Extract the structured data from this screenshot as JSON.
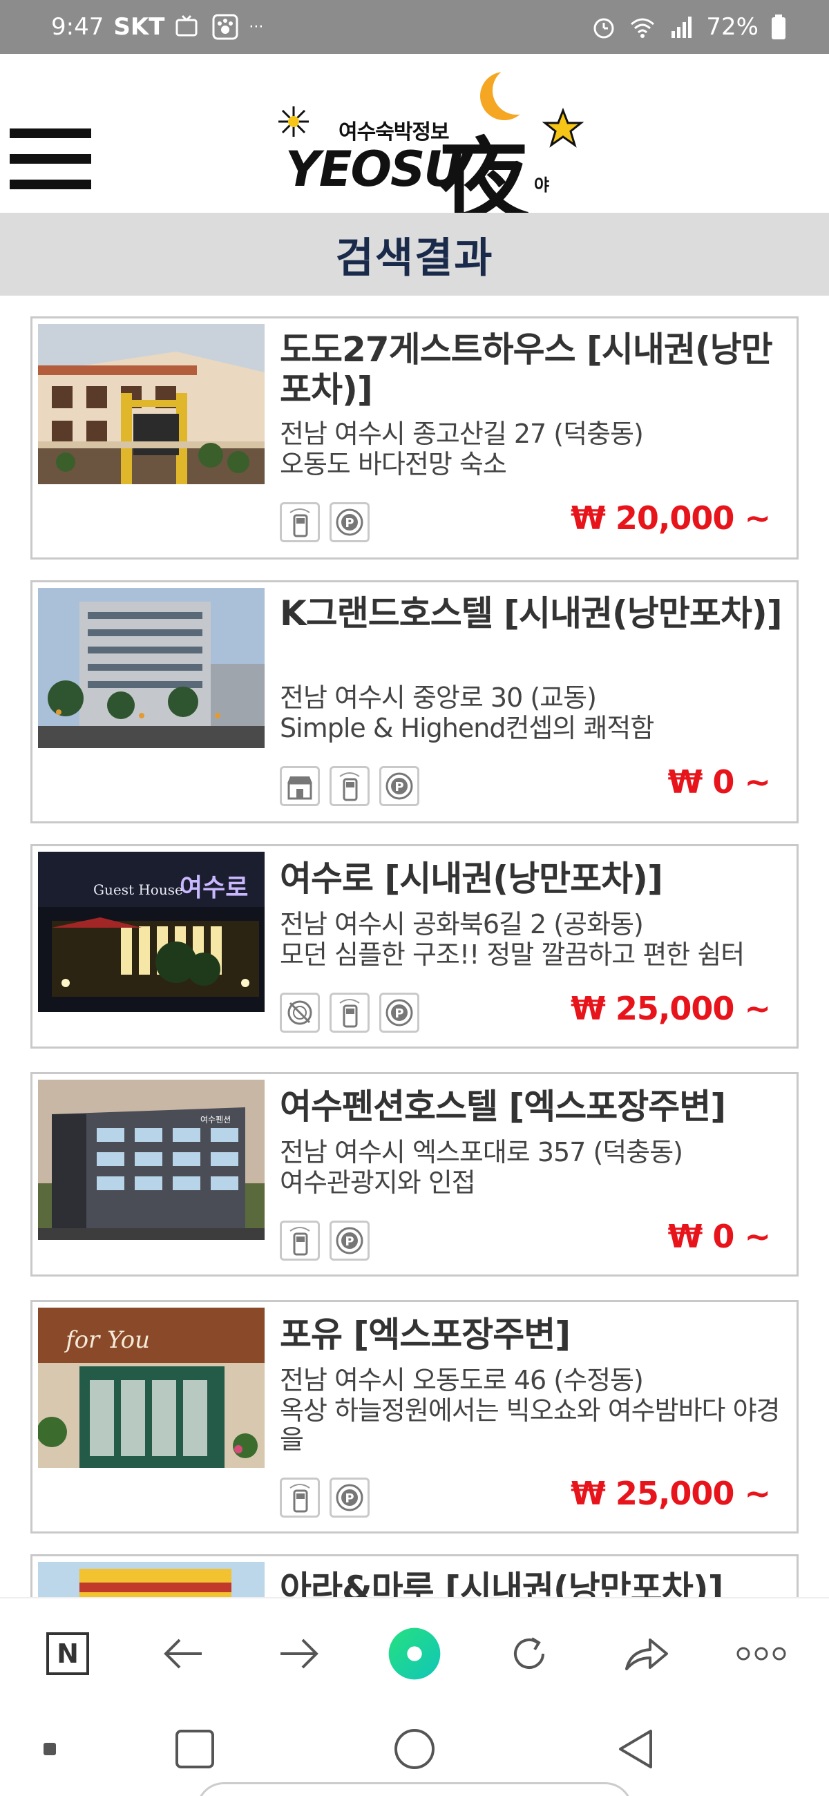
{
  "status_bar": {
    "time": "9:47",
    "carrier": "SKT",
    "extra": "···",
    "battery": "72%"
  },
  "header": {
    "logo_sub": "여수숙박정보",
    "logo_main": "YEOSU",
    "logo_hanja": "夜",
    "logo_ya": "야"
  },
  "page_title": "검색결과",
  "listings": [
    {
      "title": "도도27게스트하우스 [시내권(낭만포차)]",
      "address": "전남 여수시 종고산길 27 (덕충동)",
      "description": "오동도 바다전망 숙소",
      "price": "₩ 20,000 ~",
      "features": [
        "phone-icon",
        "parking-icon"
      ]
    },
    {
      "title": "K그랜드호스텔 [시내권(낭만포차)]",
      "address": "전남 여수시 중앙로 30 (교동)",
      "description": "Simple & Highend컨셉의 쾌적함",
      "price": "₩ 0 ~",
      "features": [
        "shop-icon",
        "phone-icon",
        "parking-icon"
      ]
    },
    {
      "title": "여수로 [시내권(낭만포차)]",
      "address": "전남 여수시 공화북6길 2 (공화동)",
      "description": "모던 심플한 구조!! 정말 깔끔하고 편한 쉼터",
      "price": "₩ 25,000 ~",
      "features": [
        "no-food-icon",
        "phone-icon",
        "parking-icon"
      ]
    },
    {
      "title": "여수펜션호스텔 [엑스포장주변]",
      "address": "전남 여수시 엑스포대로 357 (덕충동)",
      "description": "여수관광지와 인접",
      "price": "₩ 0 ~",
      "features": [
        "phone-icon",
        "parking-icon"
      ]
    },
    {
      "title": "포유 [엑스포장주변]",
      "address": "전남 여수시 오동도로 46 (수정동)",
      "description": "옥상 하늘정원에서는 빅오쇼와 여수밤바다 야경을",
      "price": "₩ 25,000 ~",
      "features": [
        "phone-icon",
        "parking-icon"
      ]
    },
    {
      "title": "아라&마루 [시내권(낭만포차)]"
    }
  ],
  "thumb_texts": {
    "guesthouse_sign": "Guest House",
    "yeosuro_sign": "여수로",
    "foryou_sign": "for You",
    "pension_sign": "여수펜션"
  },
  "browser_toolbar": {
    "naver_label": "N"
  },
  "colors": {
    "price_red": "#e8141b",
    "title_navy": "#1a2a4a",
    "titlebar_bg": "#dcdcdc",
    "statusbar_bg": "#8c8c8c",
    "green_button": "#1ed68a"
  }
}
